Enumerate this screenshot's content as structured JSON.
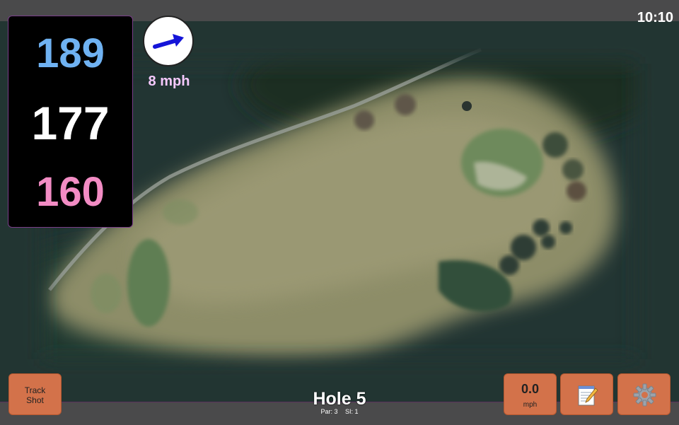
{
  "status": {
    "time": "10:10"
  },
  "distances": {
    "back": "189",
    "middle": "177",
    "front": "160",
    "back_color": "#6fb2f2",
    "middle_color": "#ffffff",
    "front_color": "#f28cc4"
  },
  "wind": {
    "speed": "8 mph",
    "speed_color": "#f6c9ff",
    "arrow_icon": "wind-direction-arrow-icon",
    "arrow_color": "#1414d8"
  },
  "hole": {
    "title": "Hole 5",
    "par": "Par: 3",
    "si": "SI: 1"
  },
  "buttons": {
    "track_shot_line1": "Track",
    "track_shot_line2": "Shot",
    "speed_value": "0.0",
    "speed_unit": "mph",
    "notes_icon": "notepad-icon",
    "settings_icon": "gear-icon"
  },
  "colors": {
    "button_bg": "#d3724a",
    "map_bg": "#223533"
  }
}
